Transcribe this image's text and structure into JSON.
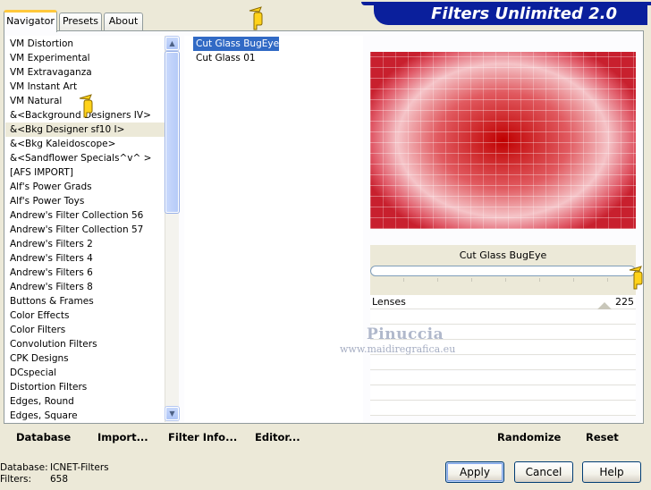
{
  "tabs": [
    {
      "label": "Navigator",
      "active": true
    },
    {
      "label": "Presets",
      "active": false
    },
    {
      "label": "About",
      "active": false
    }
  ],
  "banner": {
    "title": "Filters Unlimited 2.0"
  },
  "categories": [
    "VM Distortion",
    "VM Experimental",
    "VM Extravaganza",
    "VM Instant Art",
    "VM Natural",
    "&<Background Designers IV>",
    "&<Bkg Designer sf10 I>",
    "&<Bkg Kaleidoscope>",
    "&<Sandflower Specials^v^ >",
    "[AFS IMPORT]",
    "Alf's Power Grads",
    "Alf's Power Toys",
    "Andrew's Filter Collection 56",
    "Andrew's Filter Collection 57",
    "Andrew's Filters 2",
    "Andrew's Filters 4",
    "Andrew's Filters 6",
    "Andrew's Filters 8",
    "Buttons & Frames",
    "Color Effects",
    "Color Filters",
    "Convolution Filters",
    "CPK Designs",
    "DCspecial",
    "Distortion Filters",
    "Edges, Round",
    "Edges, Square"
  ],
  "highlighted_category_index": 6,
  "filters": [
    {
      "label": "Cut Glass  BugEye",
      "selected": true
    },
    {
      "label": "Cut Glass 01",
      "selected": false
    }
  ],
  "preview": {
    "filter_name": "Cut Glass  BugEye"
  },
  "params": [
    {
      "label": "Lenses",
      "value": "225"
    }
  ],
  "links_left": [
    "Database",
    "Import...",
    "Filter Info...",
    "Editor..."
  ],
  "links_right": [
    "Randomize",
    "Reset"
  ],
  "status": {
    "database_label": "Database:",
    "database_value": "ICNET-Filters",
    "filters_label": "Filters:",
    "filters_value": "658"
  },
  "buttons": {
    "apply": "Apply",
    "cancel": "Cancel",
    "help": "Help"
  },
  "watermark": {
    "name": "Pinuccia",
    "url": "www.maidiregrafica.eu"
  },
  "colors": {
    "banner": "#0a1f9c",
    "selection": "#316ac5",
    "tab_accent": "#ffc83c"
  }
}
